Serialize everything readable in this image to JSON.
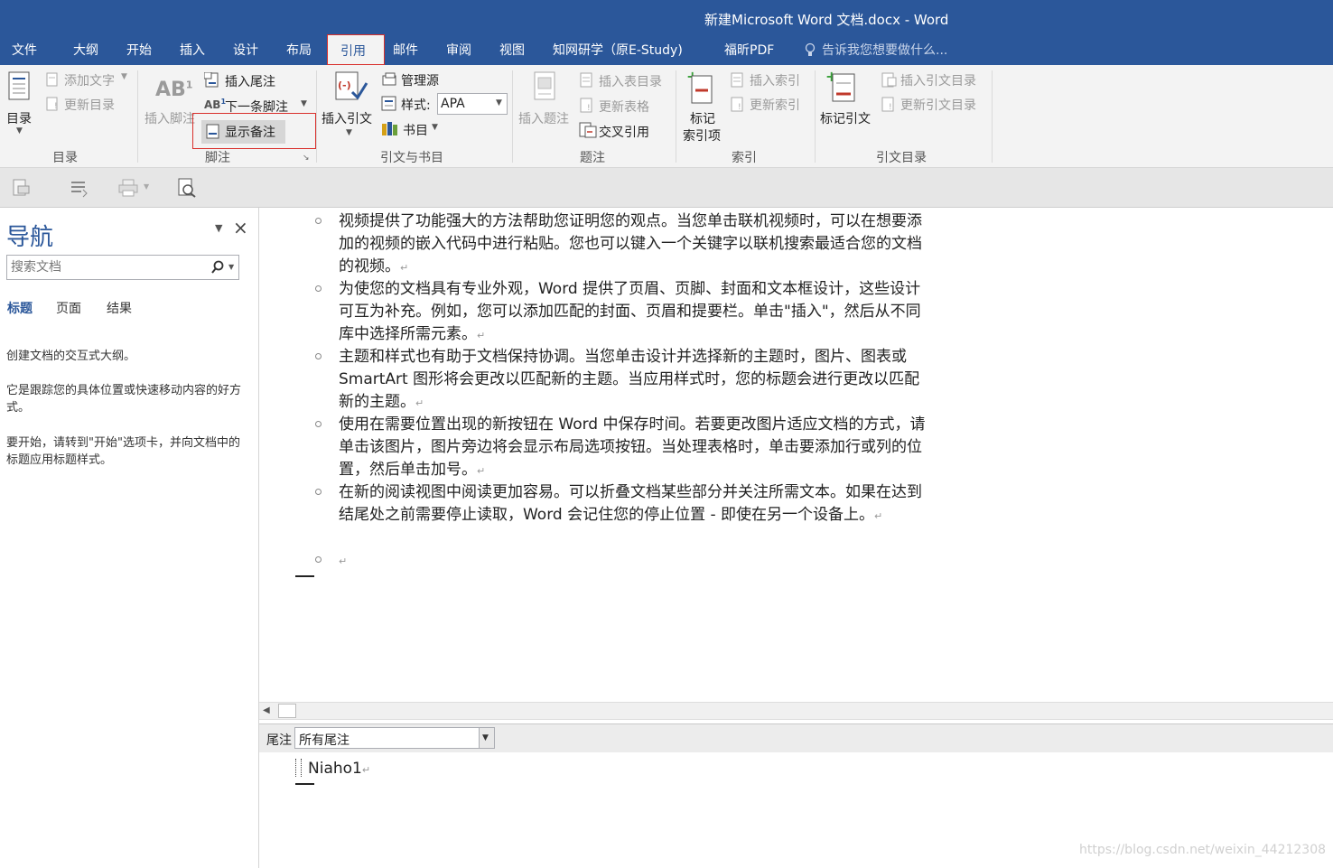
{
  "window": {
    "title": "新建Microsoft Word 文档.docx - Word"
  },
  "tabs": [
    "文件",
    "大纲",
    "开始",
    "插入",
    "设计",
    "布局",
    "引用",
    "邮件",
    "审阅",
    "视图",
    "知网研学（原E-Study)",
    "福昕PDF"
  ],
  "tell_me": "告诉我您想要做什么...",
  "ribbon": {
    "toc": {
      "big": "目录",
      "add_text": "添加文字",
      "update": "更新目录",
      "group": "目录"
    },
    "footnote": {
      "insert_footnote": "插入脚注",
      "insert_endnote": "插入尾注",
      "next_footnote": "下一条脚注",
      "show_notes": "显示备注",
      "group": "脚注"
    },
    "citations": {
      "insert_citation": "插入引文",
      "manage_sources": "管理源",
      "style_label": "样式:",
      "style_value": "APA",
      "bibliography": "书目",
      "group": "引文与书目"
    },
    "captions": {
      "insert_caption": "插入题注",
      "insert_tof": "插入表目录",
      "update_table": "更新表格",
      "cross_ref": "交叉引用",
      "group": "题注"
    },
    "index": {
      "mark_entry_1": "标记",
      "mark_entry_2": "索引项",
      "insert_index": "插入索引",
      "update_index": "更新索引",
      "group": "索引"
    },
    "toa": {
      "mark_citation": "标记引文",
      "insert_toa": "插入引文目录",
      "update_toa": "更新引文目录",
      "group": "引文目录"
    }
  },
  "nav": {
    "title": "导航",
    "search_placeholder": "搜索文档",
    "tabs": [
      "标题",
      "页面",
      "结果"
    ],
    "text1": "创建文档的交互式大纲。",
    "text2": "它是跟踪您的具体位置或快速移动内容的好方式。",
    "text3": "要开始，请转到\"开始\"选项卡，并向文档中的标题应用标题样式。"
  },
  "document": {
    "paragraphs": [
      "视频提供了功能强大的方法帮助您证明您的观点。当您单击联机视频时，可以在想要添加的视频的嵌入代码中进行粘贴。您也可以键入一个关键字以联机搜索最适合您的文档的视频。",
      "为使您的文档具有专业外观，Word 提供了页眉、页脚、封面和文本框设计，这些设计可互为补充。例如，您可以添加匹配的封面、页眉和提要栏。单击\"插入\"，然后从不同库中选择所需元素。",
      "主题和样式也有助于文档保持协调。当您单击设计并选择新的主题时，图片、图表或 SmartArt 图形将会更改以匹配新的主题。当应用样式时，您的标题会进行更改以匹配新的主题。",
      "使用在需要位置出现的新按钮在 Word 中保存时间。若要更改图片适应文档的方式，请单击该图片，图片旁边将会显示布局选项按钮。当处理表格时，单击要添加行或列的位置，然后单击加号。",
      "在新的阅读视图中阅读更加容易。可以折叠文档某些部分并关注所需文本。如果在达到结尾处之前需要停止读取，Word 会记住您的停止位置 - 即使在另一个设备上。"
    ],
    "para_mark": "↵"
  },
  "endnotes": {
    "label": "尾注",
    "select_value": "所有尾注",
    "note_text": "Niaho1"
  },
  "watermark": "https://blog.csdn.net/weixin_44212308",
  "colors": {
    "brand": "#2b579a",
    "highlight_box": "#d9302c"
  }
}
